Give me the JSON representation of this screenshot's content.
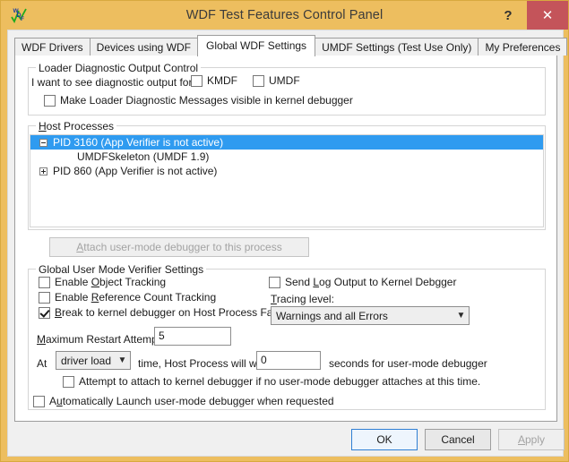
{
  "window": {
    "title": "WDF Test Features Control Panel",
    "icon": "wdf-logo-icon",
    "help_label": "?",
    "close_label": "✕",
    "frame_color": "#edbe5f",
    "close_color": "#c4545a"
  },
  "tabs": [
    {
      "label": "WDF Drivers",
      "active": false
    },
    {
      "label": "Devices using WDF",
      "active": false
    },
    {
      "label": "Global WDF Settings",
      "active": true
    },
    {
      "label": "UMDF Settings (Test Use Only)",
      "active": false
    },
    {
      "label": "My Preferences",
      "active": false
    }
  ],
  "loader_group": {
    "title": "Loader Diagnostic Output Control",
    "prompt": "I want to see diagnostic output for",
    "kmdf": {
      "label": "KMDF",
      "checked": false
    },
    "umdf": {
      "label": "UMDF",
      "checked": false
    },
    "visible_in_kd": {
      "label": "Make Loader Diagnostic Messages visible in kernel debugger",
      "checked": false
    }
  },
  "host_processes": {
    "title": "Host Processes",
    "title_accel": "H",
    "rows": [
      {
        "text": "PID 3160 (App Verifier is not active)",
        "expander": "minus",
        "indent": 0,
        "selected": true
      },
      {
        "text": "UMDFSkeleton (UMDF 1.9)",
        "expander": "none",
        "indent": 1,
        "selected": false
      },
      {
        "text": "PID 860 (App Verifier is not active)",
        "expander": "plus",
        "indent": 0,
        "selected": false
      }
    ],
    "selection_color": "#2f9bf0"
  },
  "attach_button": {
    "label": "Attach user-mode debugger to this process",
    "accel": "A",
    "enabled": false
  },
  "verifier_group": {
    "title": "Global User Mode Verifier Settings",
    "enable_object_tracking": {
      "label": "Enable Object Tracking",
      "accel": "O",
      "checked": false
    },
    "enable_refcount_tracking": {
      "label": "Enable Reference Count Tracking",
      "accel": "R",
      "checked": false
    },
    "break_to_kd": {
      "label": "Break to kernel debugger on Host Process Failure",
      "accel": "B",
      "checked": true
    },
    "send_log_to_kd": {
      "label": "Send Log Output to Kernel Debgger",
      "accel": "L",
      "checked": false
    },
    "tracing_level_label": "Tracing level:",
    "tracing_level_accel": "T",
    "tracing_level_value": "Warnings and all Errors",
    "max_restart_label": "Maximum Restart Attempts",
    "max_restart_accel": "M",
    "max_restart_value": "5",
    "at_label": "At",
    "at_time_value": "driver load",
    "wait_prefix": "time, Host Process will wait",
    "wait_seconds_value": "0",
    "wait_suffix": "seconds for user-mode debugger",
    "attempt_kd_attach": {
      "label": "Attempt to attach to kernel debugger if no user-mode debugger attaches at this time.",
      "checked": false
    },
    "auto_launch": {
      "label": "Automatically Launch user-mode debugger when requested",
      "accel": "u",
      "checked": false
    }
  },
  "footer": {
    "ok": {
      "label": "OK",
      "default": true,
      "enabled": true
    },
    "cancel": {
      "label": "Cancel",
      "enabled": true
    },
    "apply": {
      "label": "Apply",
      "accel": "A",
      "enabled": false
    }
  }
}
